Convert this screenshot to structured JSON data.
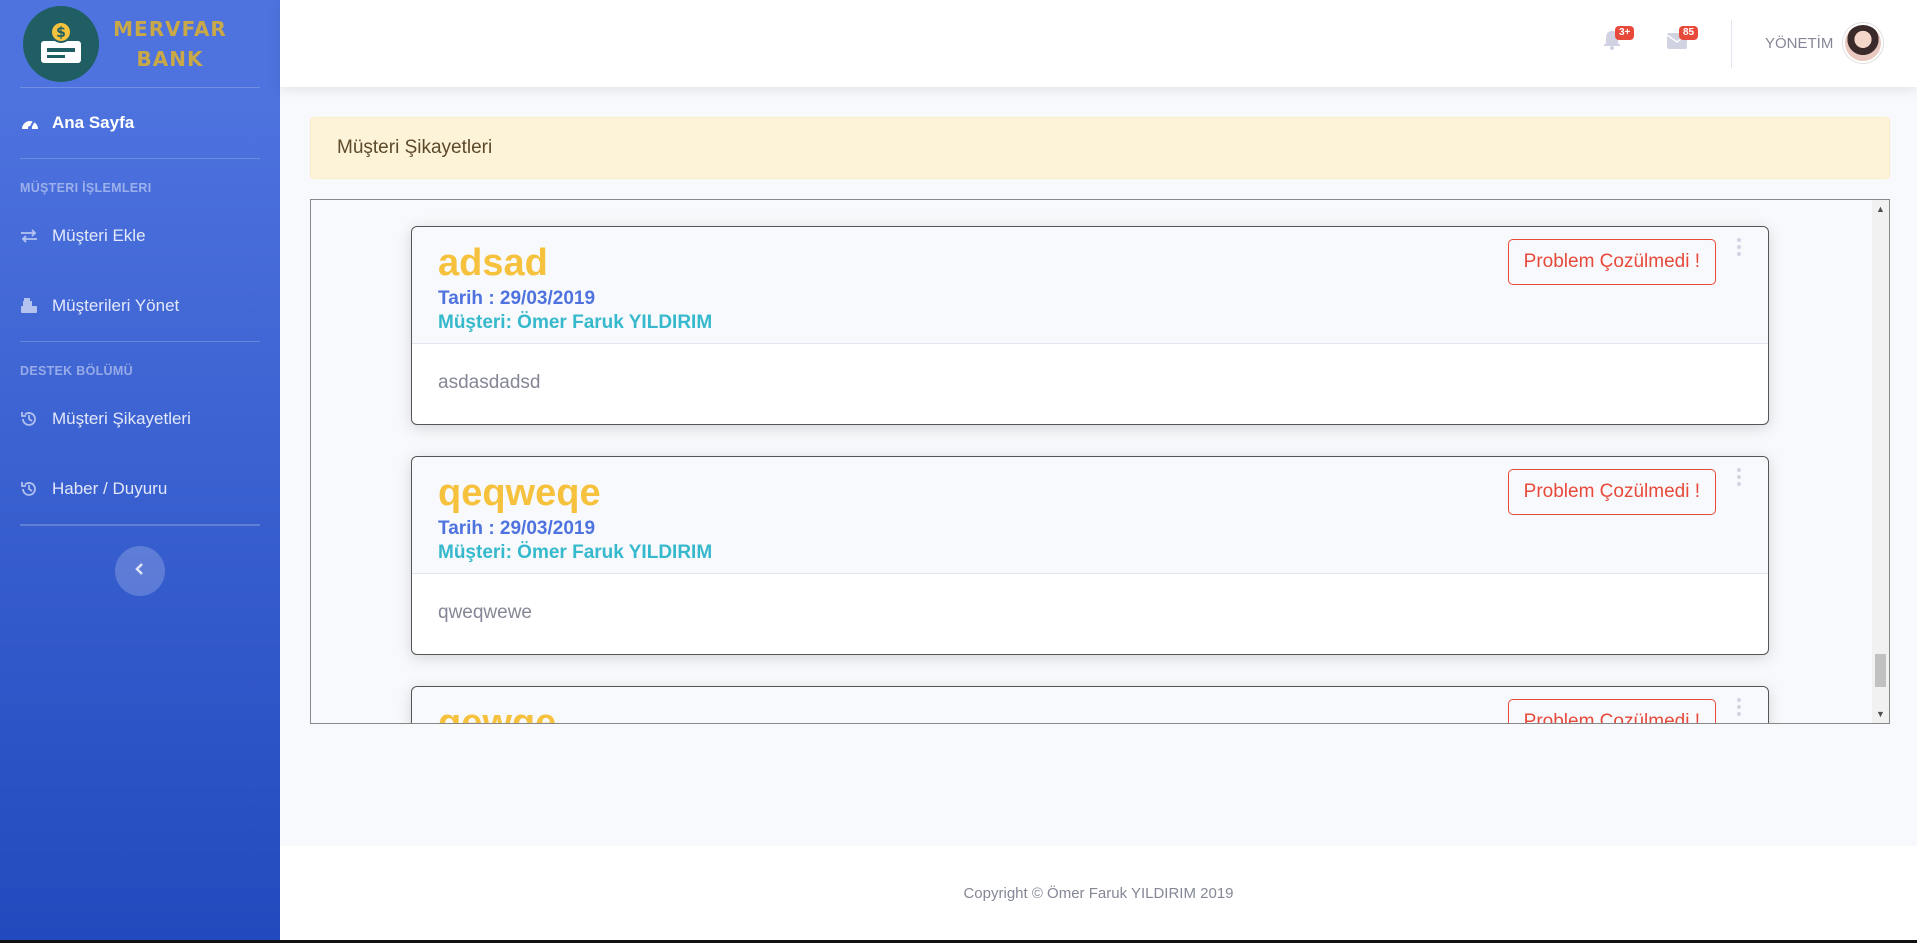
{
  "brand": {
    "line1": "MERVFAR",
    "line2": "BANK",
    "logo_icon": "money-register-icon"
  },
  "sidebar": {
    "home": {
      "label": "Ana Sayfa",
      "icon": "tachometer-icon"
    },
    "section1_heading": "MÜŞTERI İŞLEMLERI",
    "section1_items": [
      {
        "label": "Müşteri Ekle",
        "icon": "exchange-icon"
      },
      {
        "label": "Müşterileri Yönet",
        "icon": "cash-register-icon"
      }
    ],
    "section2_heading": "DESTEK BÖLÜMÜ",
    "section2_items": [
      {
        "label": "Müşteri Şikayetleri",
        "icon": "history-icon"
      },
      {
        "label": "Haber / Duyuru",
        "icon": "history-icon"
      }
    ]
  },
  "topbar": {
    "alerts_badge": "3+",
    "messages_badge": "85",
    "user_name": "YÖNETİM"
  },
  "page": {
    "heading": "Müşteri Şikayetleri"
  },
  "complaints": [
    {
      "title": "adsad",
      "date": "Tarih : 29/03/2019",
      "customer": "Müşteri: Ömer Faruk YILDIRIM",
      "status": "Problem Çozülmedi !",
      "body": "asdasdadsd"
    },
    {
      "title": "qeqweqe",
      "date": "Tarih : 29/03/2019",
      "customer": "Müşteri: Ömer Faruk YILDIRIM",
      "status": "Problem Çozülmedi !",
      "body": "qweqwewe"
    },
    {
      "title": "qewqe",
      "date": "",
      "customer": "",
      "status": "Problem Çozülmedi !",
      "body": ""
    }
  ],
  "footer": {
    "text": "Copyright © Ömer Faruk YILDIRIM 2019"
  },
  "colors": {
    "sidebar_top": "#4e73df",
    "sidebar_bottom": "#224abe",
    "title": "#f6c23e",
    "date": "#4e73df",
    "customer": "#36b9cc",
    "danger": "#e74a3b",
    "page_head_bg": "#fdf3d8"
  }
}
